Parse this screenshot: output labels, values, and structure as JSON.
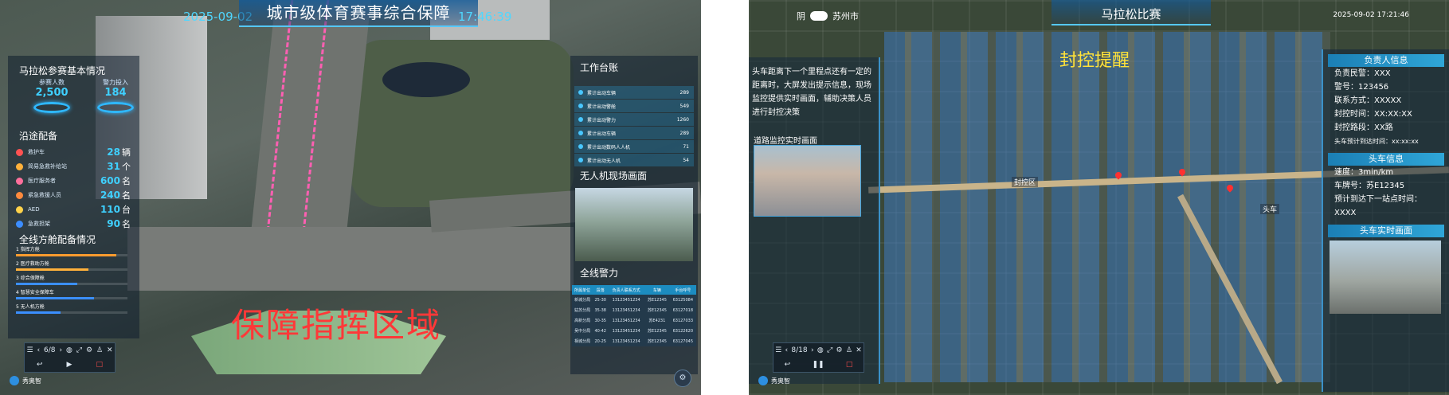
{
  "left": {
    "date": "2025-09-02",
    "title": "城市级体育赛事综合保障",
    "time": "17:46:39",
    "marathon": {
      "title": "马拉松参赛基本情况",
      "stats": [
        {
          "label": "参赛人数",
          "value": "2,500"
        },
        {
          "label": "警力投入",
          "value": "184"
        }
      ]
    },
    "equipment": {
      "title": "沿途配备",
      "items": [
        {
          "name": "救护车",
          "value": "28",
          "unit": "辆",
          "color": "#ff5252"
        },
        {
          "name": "简易急救补给站",
          "value": "31",
          "unit": "个",
          "color": "#ffb13b"
        },
        {
          "name": "医疗服务者",
          "value": "600",
          "unit": "名",
          "color": "#ff6f9c"
        },
        {
          "name": "紧急救援人员",
          "value": "240",
          "unit": "名",
          "color": "#ff8a3d"
        },
        {
          "name": "AED",
          "value": "110",
          "unit": "台",
          "color": "#ffd24a"
        },
        {
          "name": "急救担架",
          "value": "90",
          "unit": "名",
          "color": "#3c8dff"
        }
      ]
    },
    "cabin": {
      "title": "全线方舱配备情况",
      "items": [
        {
          "name": "1 指挥方舱",
          "pct": 0.9,
          "color": "#ff9b2f"
        },
        {
          "name": "2 医疗救助方舱",
          "pct": 0.65,
          "color": "#ffb13b"
        },
        {
          "name": "3 综合保障舱",
          "pct": 0.55,
          "color": "#3b8fff"
        },
        {
          "name": "4 智慧安全保障车",
          "pct": 0.7,
          "color": "#3b8fff"
        },
        {
          "name": "5 无人机方舱",
          "pct": 0.4,
          "color": "#3b8fff"
        }
      ]
    },
    "work": {
      "title": "工作台账",
      "items": [
        {
          "name": "累计出动车辆",
          "value": "289"
        },
        {
          "name": "累计出动警舱",
          "value": "549"
        },
        {
          "name": "累计出动警力",
          "value": "1260"
        },
        {
          "name": "累计出动车辆",
          "value": "289"
        },
        {
          "name": "累计出动数码人人机",
          "value": "71"
        },
        {
          "name": "累计出动无人机",
          "value": "54"
        }
      ]
    },
    "drone": {
      "title": "无人机现场画面"
    },
    "police": {
      "title": "全线警力",
      "headers": [
        "所属单位",
        "段落",
        "负责人联系方式",
        "车辆",
        "手台呼号"
      ],
      "rows": [
        [
          "新城分局",
          "25-30",
          "13123451234",
          "苏E12345",
          "63125084"
        ],
        [
          "姑苏分局",
          "35-38",
          "13123451234",
          "苏E12345",
          "63127018"
        ],
        [
          "高新分局",
          "30-35",
          "13123451234",
          "苏E4231",
          "63127033"
        ],
        [
          "吴中分局",
          "40-42",
          "13123451234",
          "苏E12345",
          "63122620"
        ],
        [
          "相城分局",
          "20-25",
          "13123451234",
          "苏E12345",
          "63127045"
        ]
      ]
    },
    "zone_label": "保障指挥区域",
    "toolbar": {
      "page": "6/8"
    },
    "logo_text": "秀奥智"
  },
  "right": {
    "weather": "阴",
    "city": "苏州市",
    "title": "马拉松比赛",
    "time": "2025-09-02 17:21:46",
    "alert": "封控提醒",
    "desc": "头车距离下一个里程点还有一定的距离时，大屏发出提示信息，现场监控提供实时画面，辅助决策人员进行封控决策",
    "road_cam_title": "道路监控实时画面",
    "map_labels": {
      "zone": "封控区",
      "car": "头车"
    },
    "leader": {
      "title": "负责人信息",
      "rows": [
        "负责民警：XXX",
        "警号：123456",
        "联系方式：XXXXX",
        "封控时间：XX:XX:XX",
        "封控路段：XX路",
        "头车预计到达时间：xx:xx:xx"
      ]
    },
    "car": {
      "title": "头车信息",
      "rows": [
        "速度：3min/km",
        "车牌号：苏E12345",
        "预计到达下一站点时间：",
        "XXXX"
      ]
    },
    "car_cam_title": "头车实时画面",
    "toolbar": {
      "page": "8/18"
    },
    "logo_text": "秀奥智"
  }
}
